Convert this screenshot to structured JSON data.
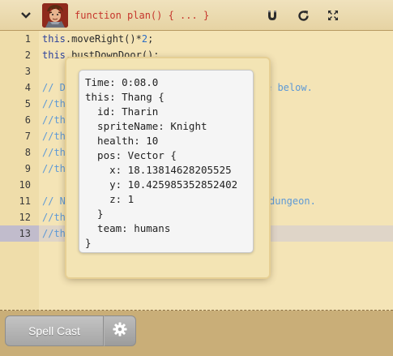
{
  "header": {
    "method_signature": "function plan() { ... }",
    "icons": {
      "collapse": "chevron-down-icon",
      "avatar": "hero-portrait",
      "magnet": "magnet-icon",
      "reload": "reload-icon",
      "fullscreen": "fullscreen-icon"
    }
  },
  "editor": {
    "active_line": 13,
    "lines": [
      {
        "n": "1",
        "tokens": [
          {
            "c": "this",
            "t": "this"
          },
          {
            "c": ".moveRight()*",
            "t": "fn"
          },
          {
            "c": "2",
            "t": "num"
          },
          {
            "c": ";",
            "t": "fn"
          }
        ]
      },
      {
        "n": "2",
        "tokens": [
          {
            "c": "this",
            "t": "this"
          },
          {
            "c": ".bustDownDoor();",
            "t": "fn"
          }
        ]
      },
      {
        "n": "3",
        "tokens": []
      },
      {
        "n": "4",
        "tokens": [
          {
            "c": "// De",
            "t": "comment"
          },
          {
            "c": "",
            "t": "gap"
          },
          {
            "c": "e below.",
            "t": "comment"
          }
        ]
      },
      {
        "n": "5",
        "tokens": [
          {
            "c": "//thi",
            "t": "comment"
          }
        ]
      },
      {
        "n": "6",
        "tokens": [
          {
            "c": "//thi",
            "t": "comment"
          }
        ]
      },
      {
        "n": "7",
        "tokens": [
          {
            "c": "//thi",
            "t": "comment"
          }
        ]
      },
      {
        "n": "8",
        "tokens": [
          {
            "c": "//thi",
            "t": "comment"
          }
        ]
      },
      {
        "n": "9",
        "tokens": [
          {
            "c": "//thi",
            "t": "comment"
          }
        ]
      },
      {
        "n": "10",
        "tokens": []
      },
      {
        "n": "11",
        "tokens": [
          {
            "c": "// No",
            "t": "comment"
          },
          {
            "c": "",
            "t": "gap"
          },
          {
            "c": "dungeon.",
            "t": "comment"
          }
        ]
      },
      {
        "n": "12",
        "tokens": [
          {
            "c": "//thi",
            "t": "comment"
          }
        ]
      },
      {
        "n": "13",
        "tokens": [
          {
            "c": "//thi",
            "t": "comment"
          }
        ]
      }
    ]
  },
  "debug_popup": {
    "lines": [
      "Time: 0:08.0",
      "this: Thang {",
      "  id: Tharin",
      "  spriteName: Knight",
      "  health: 10",
      "  pos: Vector {",
      "    x: 18.13814628205525",
      "    y: 10.425985352852402",
      "    z: 1",
      "  }",
      "  team: humans",
      "}"
    ]
  },
  "footer": {
    "spell_cast_label": "Spell Cast",
    "settings_icon": "gear-icon"
  },
  "colors": {
    "function_signature": "#c6362c",
    "keyword_this": "#2a3f9b",
    "number": "#2c6cc4",
    "comment": "#5d99d6",
    "button_gray": "#a6a6a6"
  }
}
